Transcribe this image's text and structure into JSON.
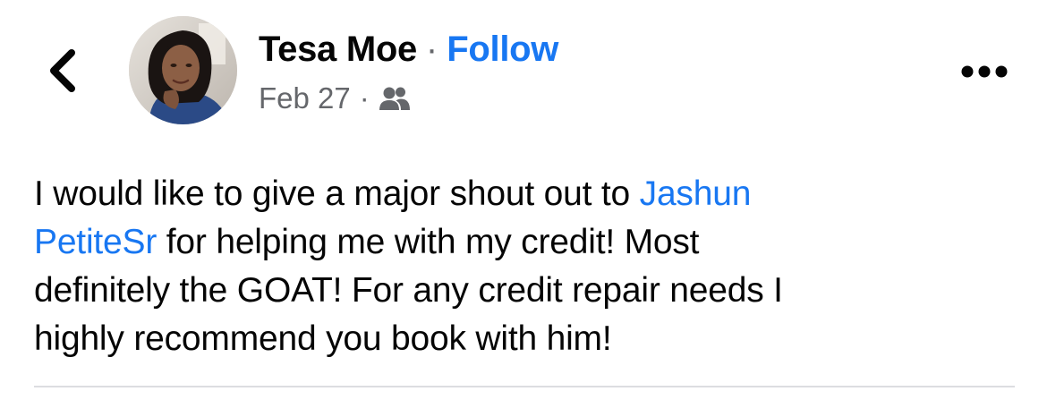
{
  "header": {
    "back_icon": "chevron-left-icon",
    "author_name": "Tesa Moe",
    "separator": "·",
    "follow_label": "Follow",
    "date": "Feb 27",
    "meta_separator": "·",
    "audience_icon": "group-audience-icon",
    "more_icon": "more-horizontal-icon"
  },
  "post": {
    "line1_text": "I would like to give a major shout out to ",
    "mention_part1": "Jashun",
    "mention_part2": "PetiteSr",
    "line2_text": " for helping me with my credit! Most",
    "line3_text": "definitely the GOAT! For any credit repair needs I",
    "line4_text": "highly recommend you book with him!"
  },
  "colors": {
    "link": "#1877f2",
    "text": "#050505",
    "secondary": "#65676b",
    "divider": "#dcdde1"
  }
}
